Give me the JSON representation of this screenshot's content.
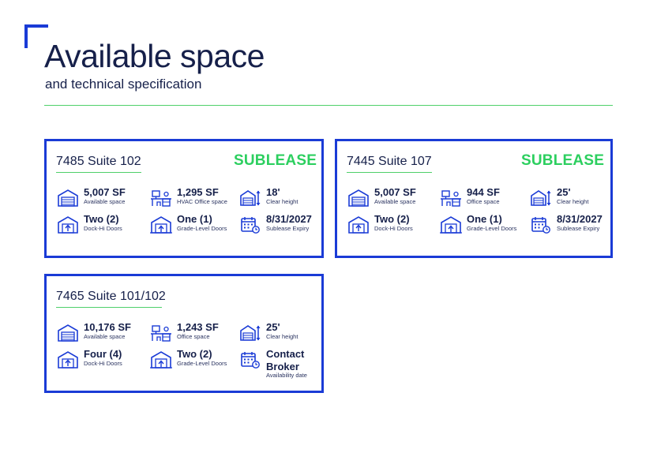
{
  "header": {
    "title": "Available space",
    "subtitle": "and technical specification"
  },
  "colors": {
    "accent": "#1a3bd6",
    "green": "#2ccf5f",
    "text": "#16204a"
  },
  "cards": [
    {
      "title": "7485 Suite 102",
      "badge": "SUBLEASE",
      "specs": [
        {
          "icon": "garage-icon",
          "value": "5,007 SF",
          "label": "Available space"
        },
        {
          "icon": "office-desk-icon",
          "value": "1,295 SF",
          "label": "HVAC Office space"
        },
        {
          "icon": "clear-height-icon",
          "value": "18'",
          "label": "Clear height"
        },
        {
          "icon": "dock-door-icon",
          "value": "Two (2)",
          "label": "Dock-Hi Doors"
        },
        {
          "icon": "grade-door-icon",
          "value": "One (1)",
          "label": "Grade-Level Doors"
        },
        {
          "icon": "calendar-icon",
          "value": "8/31/2027",
          "label": "Sublease Expiry"
        }
      ]
    },
    {
      "title": "7445 Suite 107",
      "badge": "SUBLEASE",
      "specs": [
        {
          "icon": "garage-icon",
          "value": "5,007 SF",
          "label": "Available space"
        },
        {
          "icon": "office-desk-icon",
          "value": "944 SF",
          "label": "Office space"
        },
        {
          "icon": "clear-height-icon",
          "value": "25'",
          "label": "Clear height"
        },
        {
          "icon": "dock-door-icon",
          "value": "Two (2)",
          "label": "Dock-Hi Doors"
        },
        {
          "icon": "grade-door-icon",
          "value": "One (1)",
          "label": "Grade-Level Doors"
        },
        {
          "icon": "calendar-icon",
          "value": "8/31/2027",
          "label": "Sublease Expiry"
        }
      ]
    },
    {
      "title": "7465 Suite 101/102",
      "specs": [
        {
          "icon": "garage-icon",
          "value": "10,176 SF",
          "label": "Available space"
        },
        {
          "icon": "office-desk-icon",
          "value": "1,243 SF",
          "label": "Office space"
        },
        {
          "icon": "clear-height-icon",
          "value": "25'",
          "label": "Clear height"
        },
        {
          "icon": "dock-door-icon",
          "value": "Four (4)",
          "label": "Dock-Hi Doors"
        },
        {
          "icon": "grade-door-icon",
          "value": "Two (2)",
          "label": "Grade-Level Doors"
        },
        {
          "icon": "calendar-icon",
          "value": "Contact Broker",
          "label": "Availability date"
        }
      ]
    }
  ]
}
